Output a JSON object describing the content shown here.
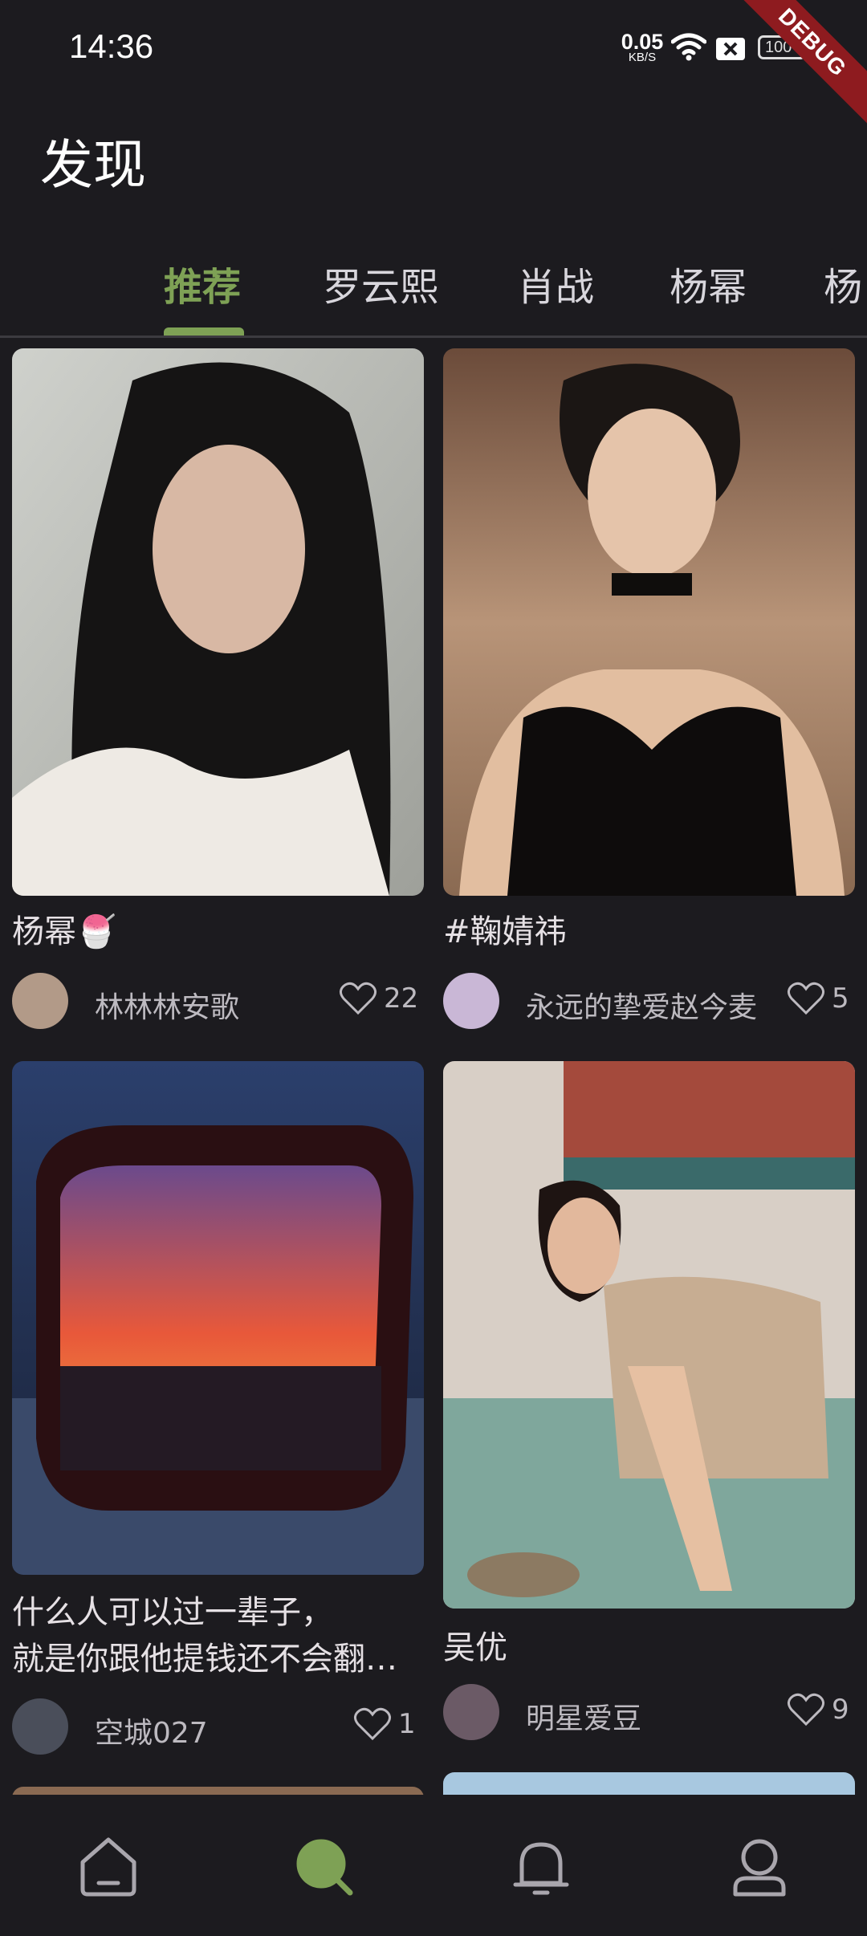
{
  "status": {
    "time": "14:36",
    "net_speed_value": "0.05",
    "net_speed_unit": "KB/S",
    "battery": "100",
    "debug_label": "DEBUG"
  },
  "page_title": "发现",
  "tabs": [
    {
      "label": "推荐",
      "active": true
    },
    {
      "label": "罗云熙",
      "active": false
    },
    {
      "label": "肖战",
      "active": false
    },
    {
      "label": "杨幂",
      "active": false
    },
    {
      "label": "杨",
      "active": false
    }
  ],
  "cards": [
    {
      "title": "杨幂🍧",
      "author": "林林林安歌",
      "likes": "22"
    },
    {
      "title": "#鞠婧祎",
      "author": "永远的挚爱赵今麦",
      "likes": "5"
    },
    {
      "title_lines": [
        "什么人可以过一辈子，",
        "就是你跟他提钱还不会翻…"
      ],
      "author": "空城027",
      "likes": "1"
    },
    {
      "title": "吴优",
      "author": "明星爱豆",
      "likes": "9"
    }
  ],
  "icons": {
    "nav": [
      "home-icon",
      "discover-icon",
      "notification-icon",
      "profile-icon"
    ],
    "like": "heart-icon"
  },
  "colors": {
    "accent": "#7ea155",
    "background": "#1c1b1f",
    "debug": "#8e1b1f"
  }
}
